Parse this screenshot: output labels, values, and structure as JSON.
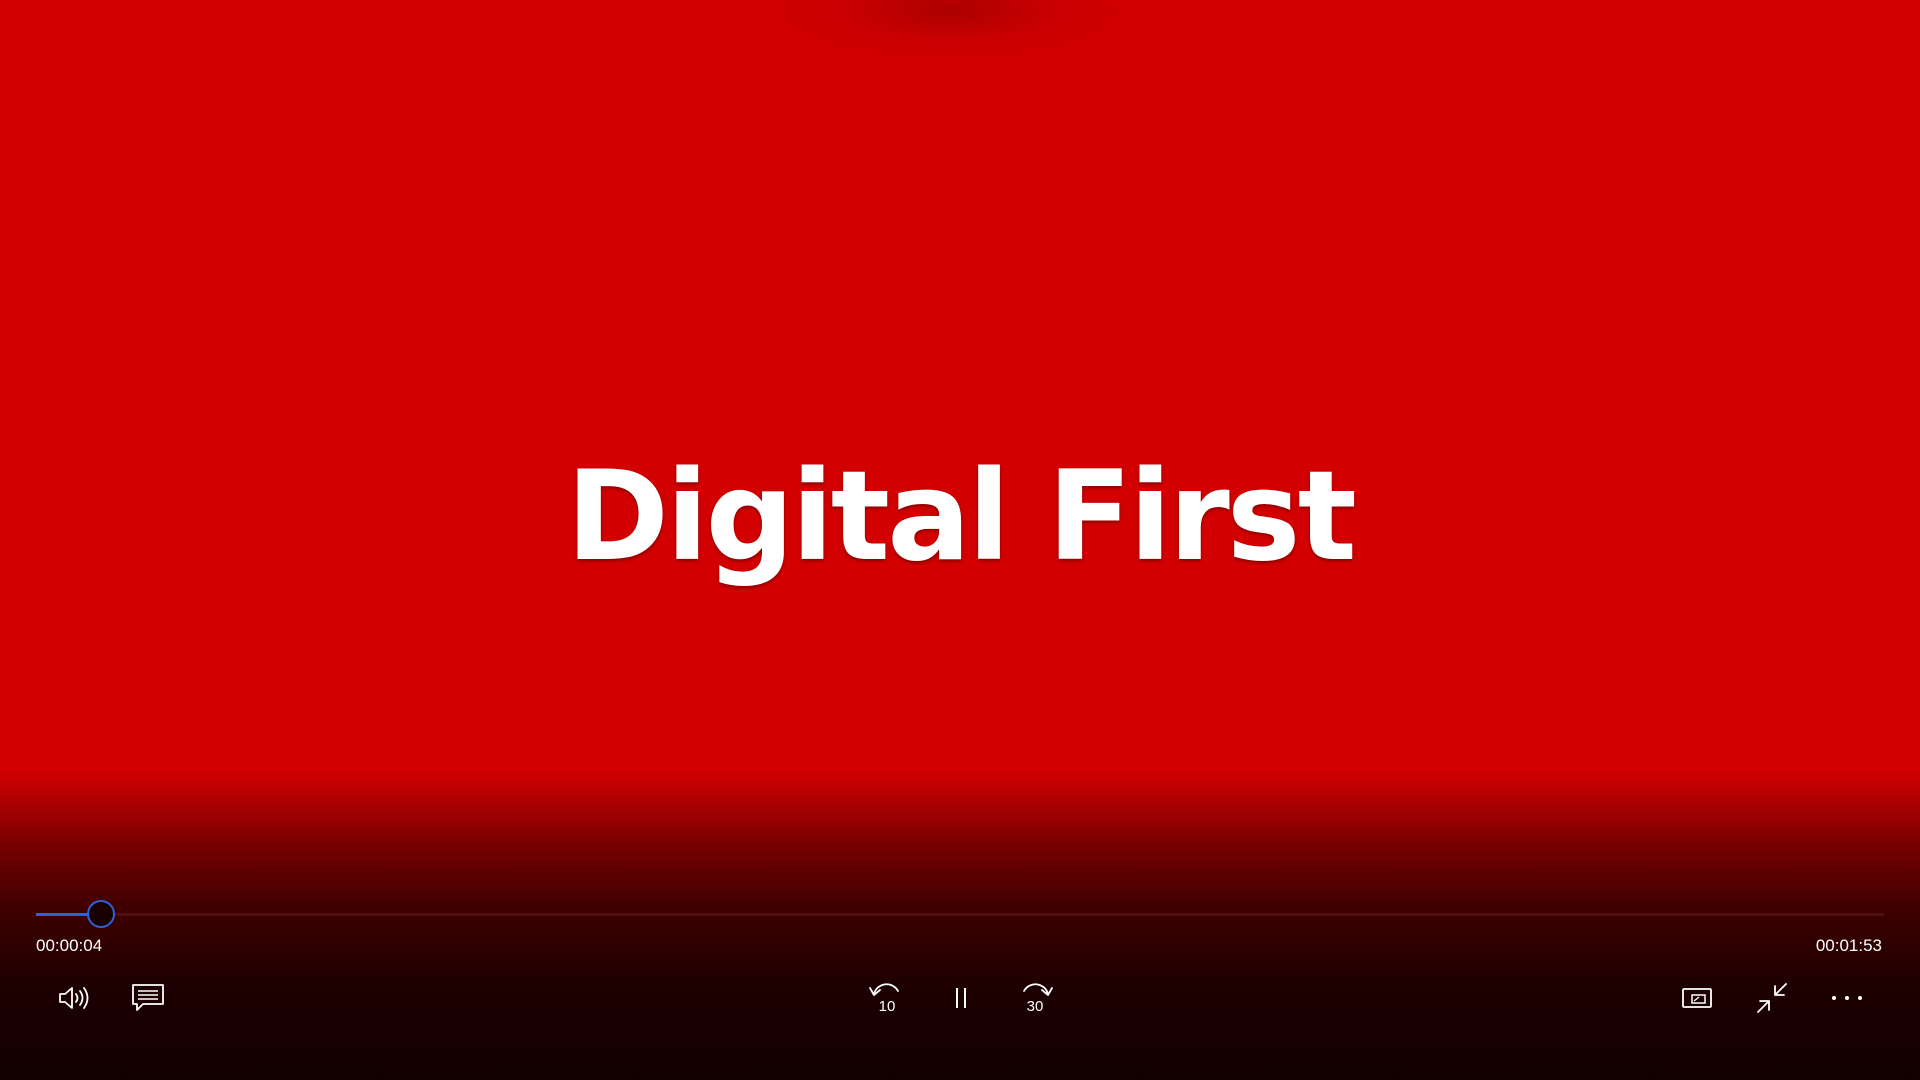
{
  "video": {
    "title_text": "Digital First",
    "background_color": "#d20000"
  },
  "seek": {
    "elapsed": "00:00:04",
    "total": "00:01:53",
    "progress_fraction": 0.0354,
    "accent_color": "#2a63d8"
  },
  "controls": {
    "volume_icon": "speaker-volume-icon",
    "captions_icon": "captions-icon",
    "skip_back_label": "10",
    "pause_icon": "pause-icon",
    "skip_forward_label": "30",
    "mini_view_icon": "mini-view-icon",
    "exit_fullscreen_icon": "exit-fullscreen-icon",
    "more_icon": "more-options-icon"
  }
}
